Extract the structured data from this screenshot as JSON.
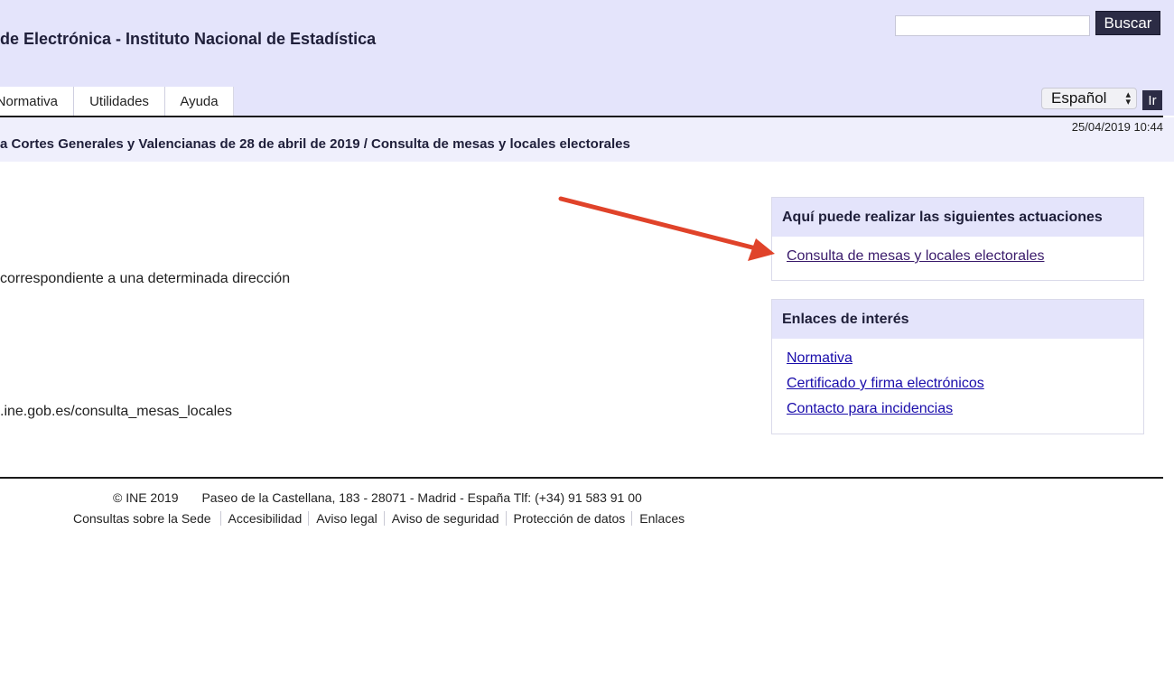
{
  "header": {
    "title": "de Electrónica - Instituto Nacional de Estadística",
    "search_placeholder": "",
    "search_button": "Buscar",
    "language_selected": "Español",
    "go_button": "Ir"
  },
  "nav": {
    "tabs": [
      {
        "label": "Normativa"
      },
      {
        "label": "Utilidades"
      },
      {
        "label": "Ayuda"
      }
    ]
  },
  "crumb": {
    "datetime": "25/04/2019 10:44",
    "text": "a Cortes Generales y Valencianas de 28 de abril de 2019 / Consulta de mesas y locales electorales"
  },
  "main": {
    "text_1": " correspondiente a una determinada dirección",
    "text_2": ".ine.gob.es/consulta_mesas_locales"
  },
  "sidebar": {
    "actions": {
      "title": "Aquí puede realizar las siguientes actuaciones",
      "links": [
        "Consulta de mesas y locales electorales"
      ]
    },
    "links_box": {
      "title": "Enlaces de interés",
      "links": [
        "Normativa",
        "Certificado y firma electrónicos",
        "Contacto para incidencias"
      ]
    }
  },
  "footer": {
    "copyright": "©  INE 2019",
    "address": "Paseo de la Castellana, 183 - 28071 - Madrid - España Tlf: (+34) 91 583 91 00",
    "links": [
      "Consultas sobre la Sede",
      "Accesibilidad",
      "Aviso legal",
      "Aviso de seguridad",
      "Protección de datos",
      "Enlaces"
    ]
  },
  "colors": {
    "header_bg": "#e4e4fb",
    "button_bg": "#2c2c45",
    "link": "#1a0dab",
    "annotation_arrow": "#e0432a"
  },
  "icons": {
    "annotation": "arrow-right-icon",
    "select": "chevron-updown-icon"
  }
}
